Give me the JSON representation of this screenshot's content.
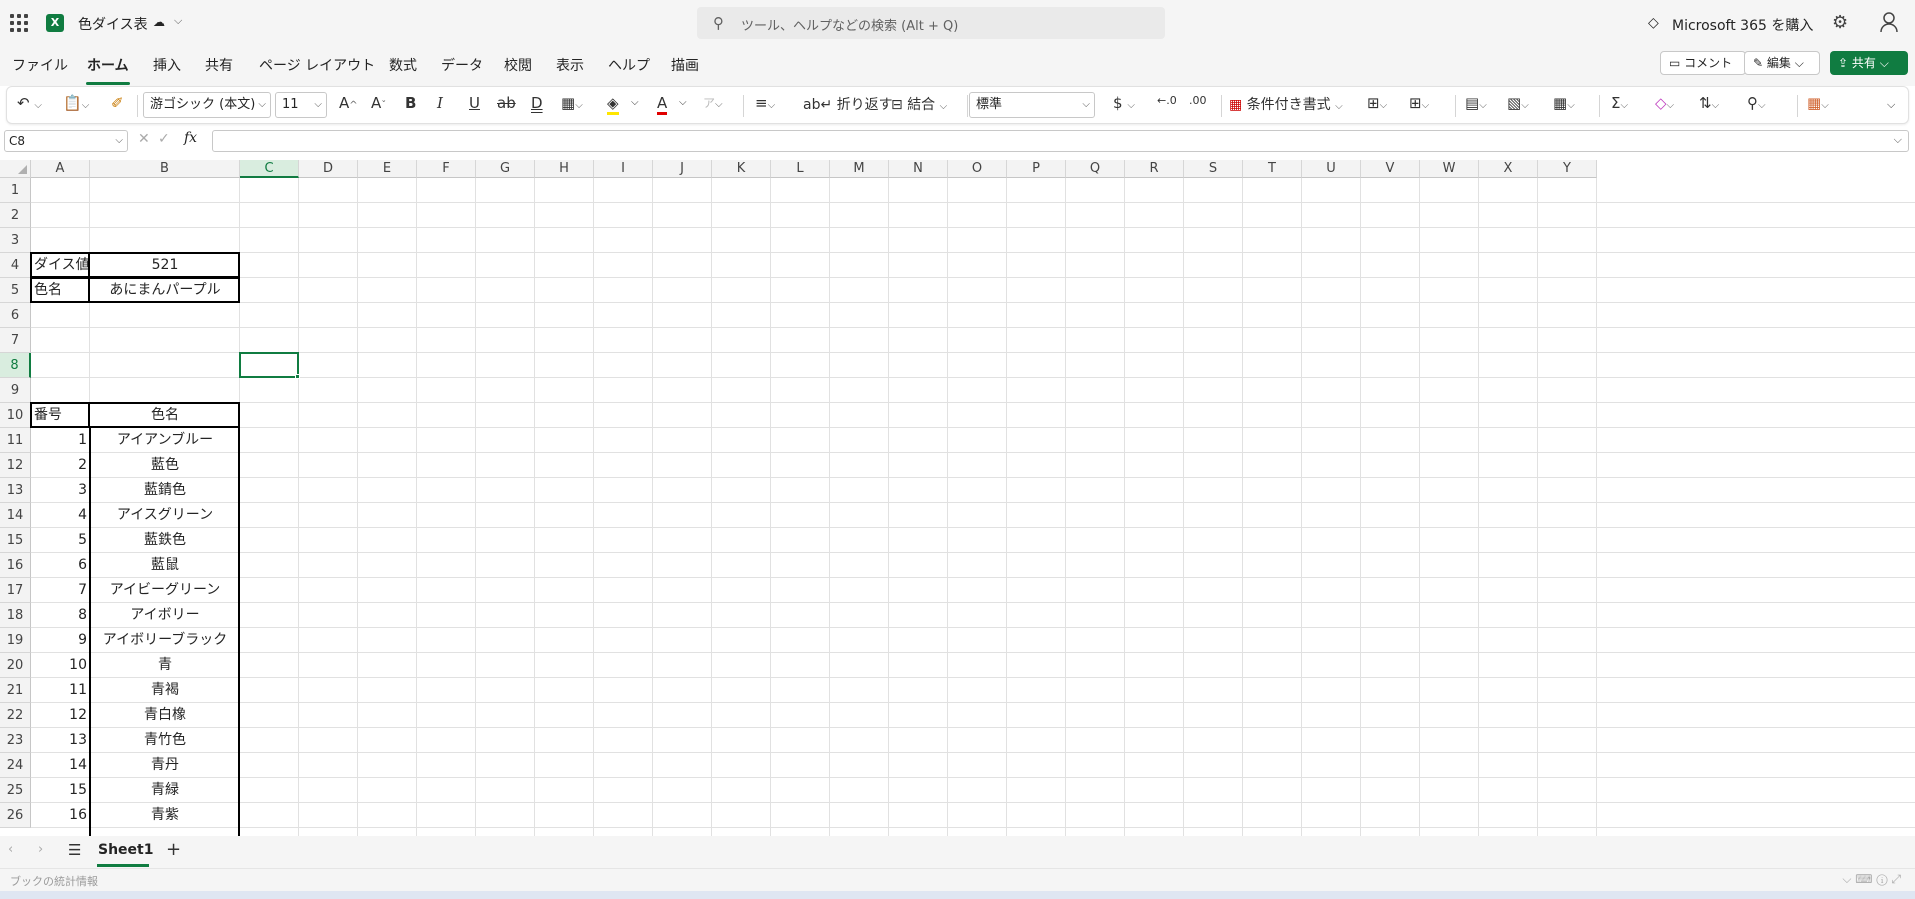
{
  "app": {
    "title": "色ダイス表",
    "search_placeholder": "ツール、ヘルプなどの検索 (Alt + Q)",
    "m365_label": "Microsoft 365 を購入",
    "brand_color": "#107c41"
  },
  "tabs": [
    {
      "label": "ファイル"
    },
    {
      "label": "ホーム"
    },
    {
      "label": "挿入"
    },
    {
      "label": "共有"
    },
    {
      "label": "ページ レイアウト"
    },
    {
      "label": "数式"
    },
    {
      "label": "データ"
    },
    {
      "label": "校閲"
    },
    {
      "label": "表示"
    },
    {
      "label": "ヘルプ"
    },
    {
      "label": "描画"
    }
  ],
  "actions": {
    "comment": "コメント",
    "edit": "編集",
    "share": "共有"
  },
  "ribbon": {
    "font_name": "游ゴシック (本文)",
    "font_size": "11",
    "wrap_text": "折り返す",
    "merge": "結合",
    "number_format": "標準",
    "conditional_format": "条件付き書式"
  },
  "formula_bar": {
    "name_box": "C8",
    "formula": ""
  },
  "grid": {
    "columns": [
      "A",
      "B",
      "C",
      "D",
      "E",
      "F",
      "G",
      "H",
      "I",
      "J",
      "K",
      "L",
      "M",
      "N",
      "O",
      "P",
      "Q",
      "R",
      "S",
      "T",
      "U",
      "V",
      "W",
      "X",
      "Y"
    ],
    "selected_column": "C",
    "rows": [
      "1",
      "2",
      "3",
      "4",
      "5",
      "6",
      "7",
      "8",
      "9",
      "10",
      "11",
      "12",
      "13",
      "14",
      "15",
      "16",
      "17",
      "18",
      "19",
      "20",
      "21",
      "22",
      "23",
      "24",
      "25",
      "26"
    ],
    "selected_row": "8",
    "dice_label": "ダイス値",
    "dice_value": "521",
    "color_label": "色名",
    "color_value": "あにまんパープル",
    "table_header_no": "番号",
    "table_header_name": "色名",
    "table_rows": [
      {
        "no": "1",
        "name": "アイアンブルー"
      },
      {
        "no": "2",
        "name": "藍色"
      },
      {
        "no": "3",
        "name": "藍錆色"
      },
      {
        "no": "4",
        "name": "アイスグリーン"
      },
      {
        "no": "5",
        "name": "藍鉄色"
      },
      {
        "no": "6",
        "name": "藍鼠"
      },
      {
        "no": "7",
        "name": "アイビーグリーン"
      },
      {
        "no": "8",
        "name": "アイボリー"
      },
      {
        "no": "9",
        "name": "アイボリーブラック"
      },
      {
        "no": "10",
        "name": "青"
      },
      {
        "no": "11",
        "name": "青褐"
      },
      {
        "no": "12",
        "name": "青白橡"
      },
      {
        "no": "13",
        "name": "青竹色"
      },
      {
        "no": "14",
        "name": "青丹"
      },
      {
        "no": "15",
        "name": "青緑"
      },
      {
        "no": "16",
        "name": "青紫"
      }
    ]
  },
  "sheets": [
    {
      "label": "Sheet1",
      "active": true
    }
  ],
  "status": {
    "stats_label": "ブックの統計情報"
  }
}
